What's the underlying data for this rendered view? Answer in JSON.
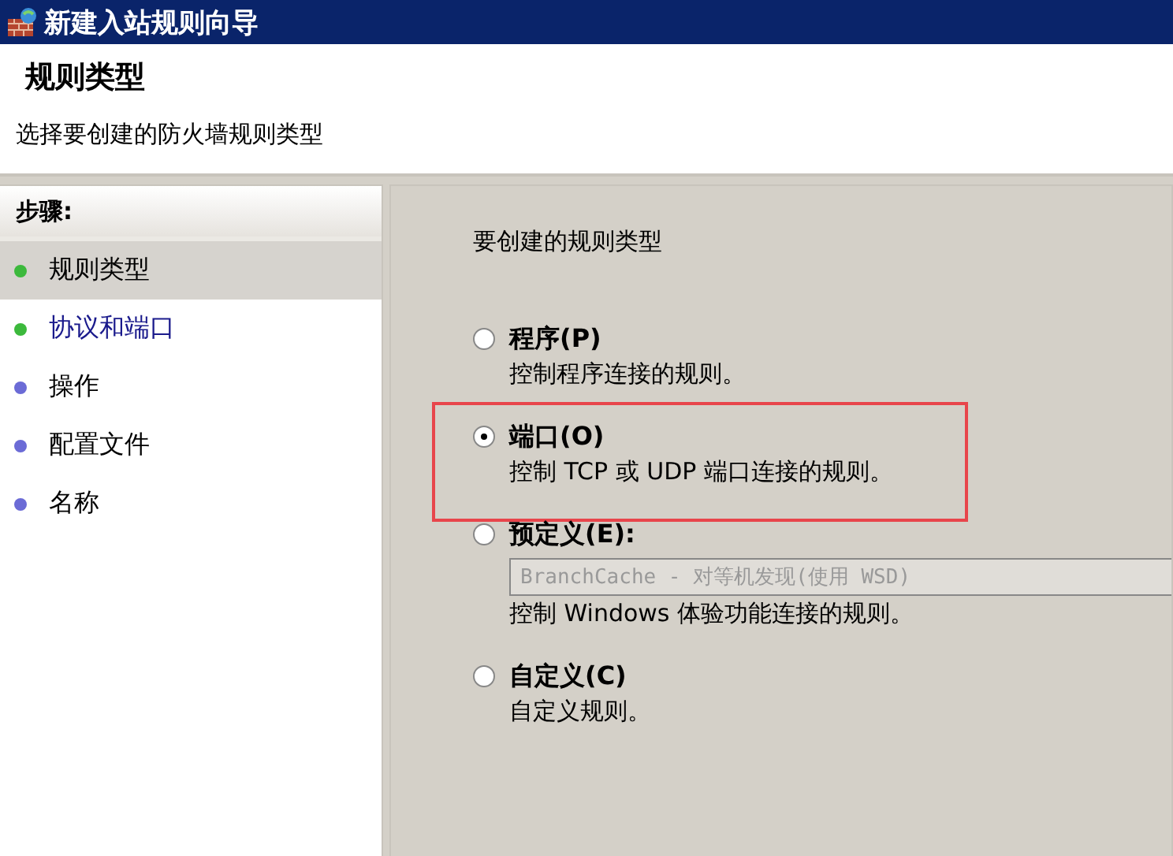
{
  "window": {
    "title": "新建入站规则向导"
  },
  "header": {
    "title": "规则类型",
    "subtitle": "选择要创建的防火墙规则类型"
  },
  "steps": {
    "heading": "步骤:",
    "items": [
      {
        "label": "规则类型",
        "color": "#3cb93c",
        "selected": true,
        "kind": "plain"
      },
      {
        "label": "协议和端口",
        "color": "#3cb93c",
        "selected": false,
        "kind": "link"
      },
      {
        "label": "操作",
        "color": "#6b6bd6",
        "selected": false,
        "kind": "plain"
      },
      {
        "label": "配置文件",
        "color": "#6b6bd6",
        "selected": false,
        "kind": "plain"
      },
      {
        "label": "名称",
        "color": "#6b6bd6",
        "selected": false,
        "kind": "plain"
      }
    ]
  },
  "content": {
    "prompt": "要创建的规则类型",
    "options": [
      {
        "label": "程序(P)",
        "description": "控制程序连接的规则。",
        "selected": false,
        "highlighted": false
      },
      {
        "label": "端口(O)",
        "description": "控制 TCP 或 UDP 端口连接的规则。",
        "selected": true,
        "highlighted": true
      },
      {
        "label": "预定义(E):",
        "dropdown": {
          "value": "BranchCache - 对等机发现(使用 WSD)",
          "disabled": true
        },
        "description": "控制 Windows 体验功能连接的规则。",
        "selected": false,
        "highlighted": false
      },
      {
        "label": "自定义(C)",
        "description": "自定义规则。",
        "selected": false,
        "highlighted": false
      }
    ]
  }
}
